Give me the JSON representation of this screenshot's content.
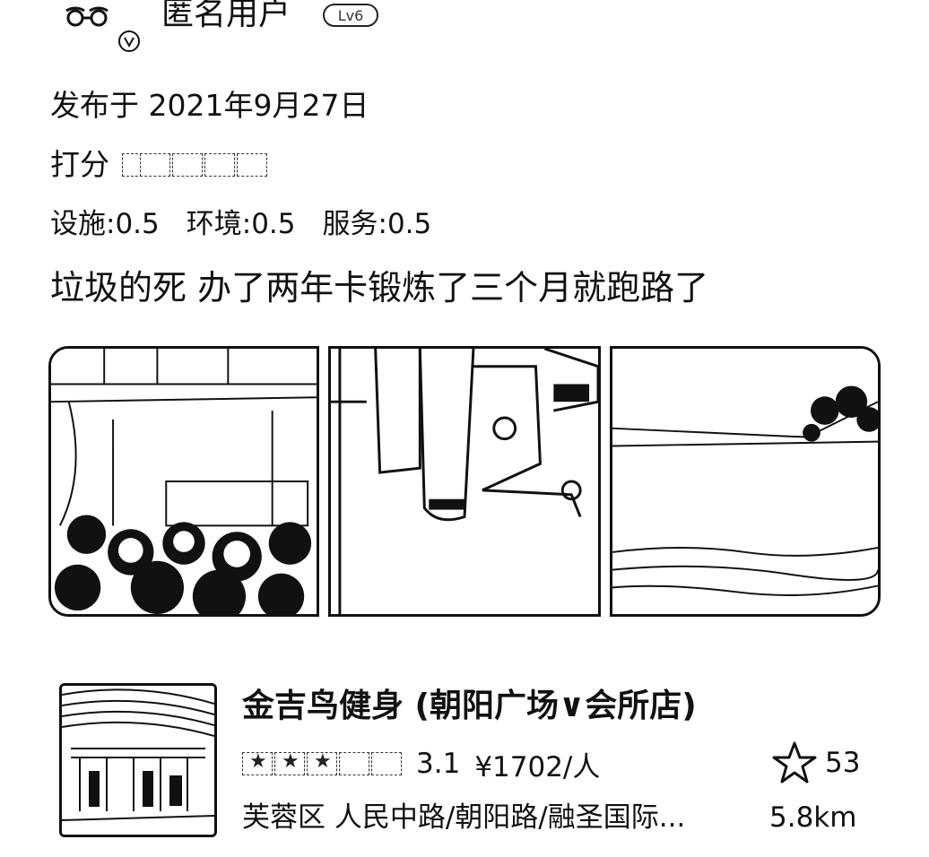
{
  "user": {
    "name": "匿名用户",
    "badge": "Lv6"
  },
  "review": {
    "published": "发布于 2021年9月27日",
    "rating_label": "打分",
    "rating_stars": 0.5,
    "sub_scores": [
      {
        "label": "设施:0.5"
      },
      {
        "label": "环境:0.5"
      },
      {
        "label": "服务:0.5"
      }
    ],
    "text": "垃圾的死 办了两年卡锻炼了三个月就跑路了",
    "photos": [
      "photo-crowd-room",
      "photo-gym-machine",
      "photo-water-scene"
    ]
  },
  "shop": {
    "name": "金吉鸟健身 (朝阳广场∨会所店)",
    "stars": 3.5,
    "rating": "3.1",
    "price": "¥1702/人",
    "favorites": "53",
    "address": "芙蓉区 人民中路/朝阳路/融圣国际...",
    "distance": "5.8km"
  },
  "icons": {
    "favorite": "star-outline-icon",
    "avatar": "glasses-avatar-icon"
  }
}
